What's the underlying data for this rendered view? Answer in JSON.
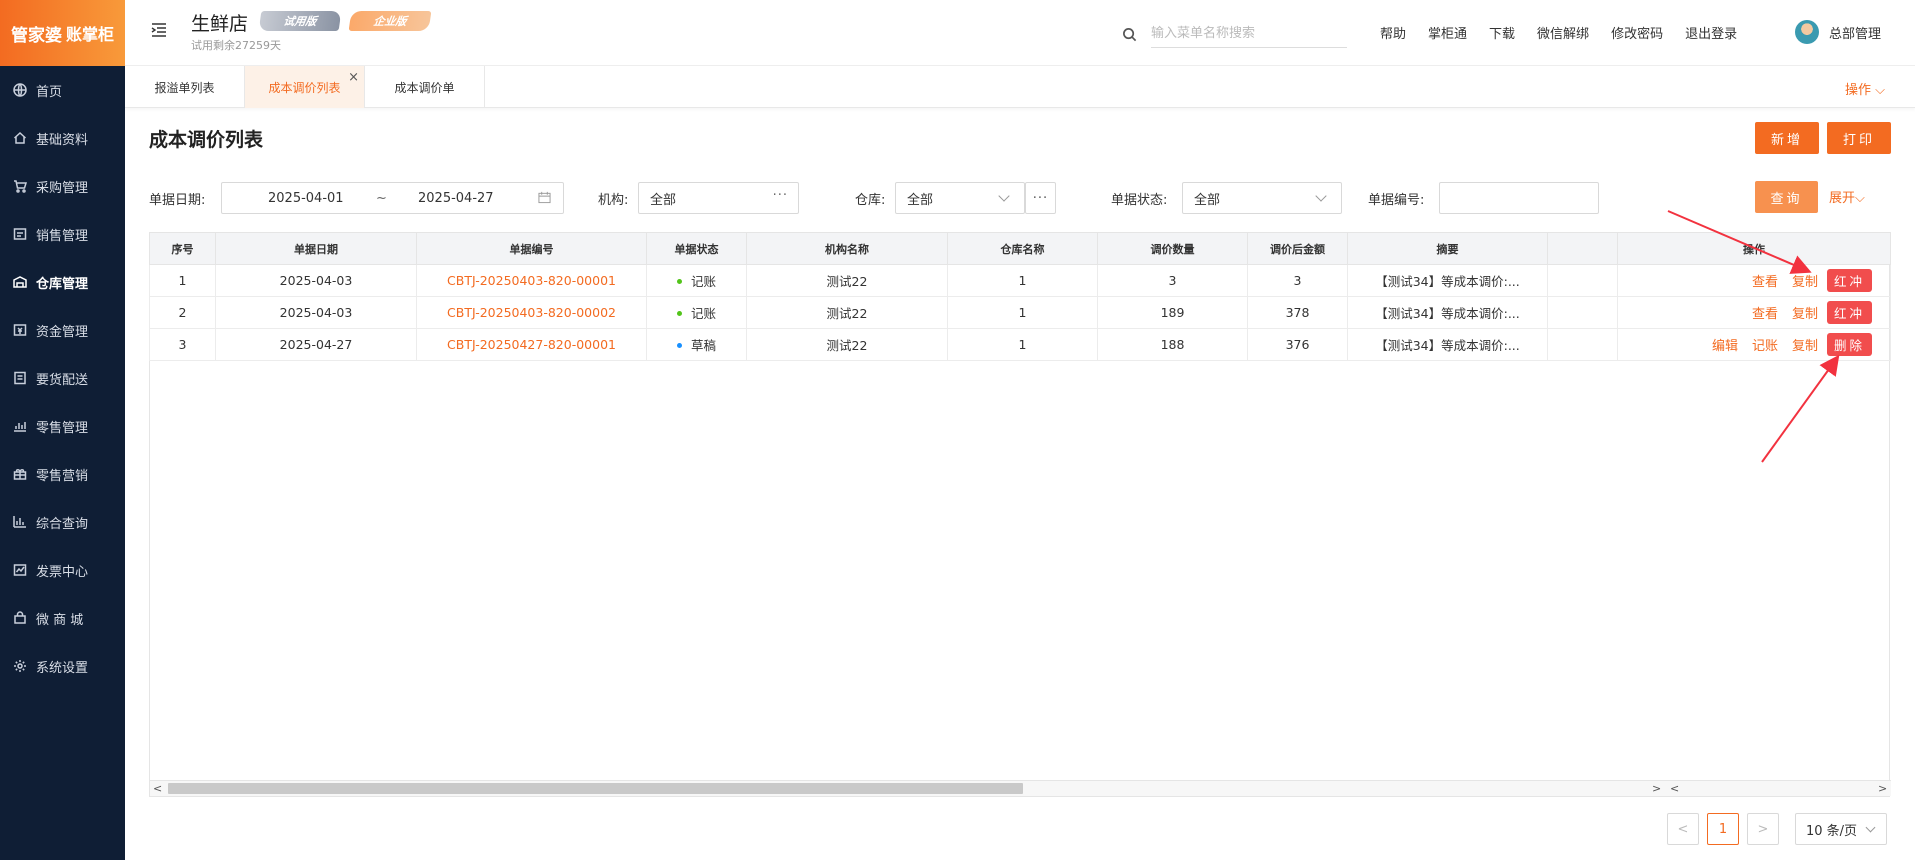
{
  "sidebar": {
    "logo_main": "管家婆",
    "logo_sub": "账掌柜",
    "items": [
      {
        "label": "首页",
        "icon": "globe-icon"
      },
      {
        "label": "基础资料",
        "icon": "home-icon"
      },
      {
        "label": "采购管理",
        "icon": "cart-icon"
      },
      {
        "label": "销售管理",
        "icon": "receipt-icon"
      },
      {
        "label": "仓库管理",
        "icon": "warehouse-icon"
      },
      {
        "label": "资金管理",
        "icon": "money-icon"
      },
      {
        "label": "要货配送",
        "icon": "document-icon"
      },
      {
        "label": "零售管理",
        "icon": "chart-icon"
      },
      {
        "label": "零售营销",
        "icon": "gift-icon"
      },
      {
        "label": "综合查询",
        "icon": "bar-chart-icon"
      },
      {
        "label": "发票中心",
        "icon": "invoice-icon"
      },
      {
        "label": "微 商 城",
        "icon": "bag-icon"
      },
      {
        "label": "系统设置",
        "icon": "gear-icon"
      }
    ]
  },
  "header": {
    "store_name": "生鲜店",
    "trial_badge": "试用版",
    "enterprise_badge": "企业版",
    "trial_remaining": "试用剩余27259天",
    "search_placeholder": "输入菜单名称搜索",
    "links": [
      "帮助",
      "掌柜通",
      "下载",
      "微信解绑",
      "修改密码",
      "退出登录"
    ],
    "user_name": "总部管理"
  },
  "tabs": [
    {
      "label": "报溢单列表"
    },
    {
      "label": "成本调价列表"
    },
    {
      "label": "成本调价单"
    }
  ],
  "ops_menu": "操作",
  "page": {
    "title": "成本调价列表",
    "add_button": "新增",
    "print_button": "打印",
    "query_button": "查询",
    "expand_link": "展开"
  },
  "filters": {
    "date_label": "单据日期:",
    "date_start": "2025-04-01",
    "date_sep": "~",
    "date_end": "2025-04-27",
    "org_label": "机构:",
    "org_value": "全部",
    "warehouse_label": "仓库:",
    "warehouse_value": "全部",
    "status_label": "单据状态:",
    "status_value": "全部",
    "number_label": "单据编号:",
    "number_value": ""
  },
  "table": {
    "columns": [
      "序号",
      "单据日期",
      "单据编号",
      "单据状态",
      "机构名称",
      "仓库名称",
      "调价数量",
      "调价后金额",
      "摘要",
      "",
      "操作"
    ],
    "rows": [
      {
        "no": "1",
        "date": "2025-04-03",
        "code": "CBTJ-20250403-820-00001",
        "status": "记账",
        "status_color": "#52c41a",
        "org": "测试22",
        "warehouse": "1",
        "qty": "3",
        "amount": "3",
        "summary": "【测试34】等成本调价:...",
        "actions": [
          "查看",
          "复制"
        ],
        "red_action": "红冲"
      },
      {
        "no": "2",
        "date": "2025-04-03",
        "code": "CBTJ-20250403-820-00002",
        "status": "记账",
        "status_color": "#52c41a",
        "org": "测试22",
        "warehouse": "1",
        "qty": "189",
        "amount": "378",
        "summary": "【测试34】等成本调价:...",
        "actions": [
          "查看",
          "复制"
        ],
        "red_action": "红冲"
      },
      {
        "no": "3",
        "date": "2025-04-27",
        "code": "CBTJ-20250427-820-00001",
        "status": "草稿",
        "status_color": "#1890ff",
        "org": "测试22",
        "warehouse": "1",
        "qty": "188",
        "amount": "376",
        "summary": "【测试34】等成本调价:...",
        "actions": [
          "编辑",
          "记账",
          "复制"
        ],
        "red_action": "删除"
      }
    ]
  },
  "pagination": {
    "prev": "<",
    "current": "1",
    "next": ">",
    "page_size": "10 条/页"
  },
  "colors": {
    "accent": "#f36b21",
    "sidebar_bg": "#0f1e35",
    "danger": "#f14d4d"
  }
}
